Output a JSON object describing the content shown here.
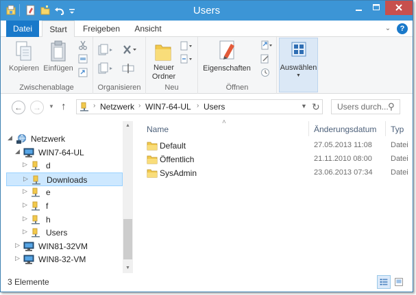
{
  "window": {
    "title": "Users",
    "accent": "#3c95d6",
    "close_color": "#c7504d"
  },
  "quick_access": {
    "icons": [
      "folder-properties-icon",
      "new-folder-icon",
      "undo-icon",
      "customize-dropdown-icon"
    ]
  },
  "ribbon_tabs": [
    {
      "label": "Datei"
    },
    {
      "label": "Start"
    },
    {
      "label": "Freigeben"
    },
    {
      "label": "Ansicht"
    }
  ],
  "help": {
    "label": "?"
  },
  "ribbon": {
    "zwischenablage": {
      "label": "Zwischenablage",
      "kopieren": "Kopieren",
      "einfuegen": "Einfügen"
    },
    "organisieren": {
      "label": "Organisieren"
    },
    "neu": {
      "label": "Neu",
      "neuer": "Neuer",
      "ordner": "Ordner"
    },
    "oeffnen": {
      "label": "Öffnen",
      "eigenschaften": "Eigenschaften"
    },
    "auswaehlen": {
      "label": "Auswählen"
    }
  },
  "address": {
    "crumbs": [
      "Netzwerk",
      "WIN7-64-UL",
      "Users"
    ]
  },
  "search": {
    "placeholder": "Users durch..."
  },
  "tree": [
    {
      "label": "Netzwerk",
      "level": 0,
      "expanded": true,
      "icon": "network-icon"
    },
    {
      "label": "WIN7-64-UL",
      "level": 1,
      "expanded": true,
      "icon": "computer-icon"
    },
    {
      "label": "d",
      "level": 2,
      "expanded": false,
      "icon": "share-folder-icon"
    },
    {
      "label": "Downloads",
      "level": 2,
      "expanded": false,
      "icon": "share-folder-icon",
      "selected": true
    },
    {
      "label": "e",
      "level": 2,
      "expanded": false,
      "icon": "share-folder-icon"
    },
    {
      "label": "f",
      "level": 2,
      "expanded": false,
      "icon": "share-folder-icon"
    },
    {
      "label": "h",
      "level": 2,
      "expanded": false,
      "icon": "share-folder-icon"
    },
    {
      "label": "Users",
      "level": 2,
      "expanded": false,
      "icon": "share-folder-icon"
    },
    {
      "label": "WIN81-32VM",
      "level": 1,
      "expanded": false,
      "icon": "computer-icon"
    },
    {
      "label": "WIN8-32-VM",
      "level": 1,
      "expanded": false,
      "icon": "computer-icon"
    }
  ],
  "columns": {
    "name": "Name",
    "date": "Änderungsdatum",
    "type": "Typ"
  },
  "files": [
    {
      "name": "Default",
      "date": "27.05.2013 11:08",
      "type": "Datei"
    },
    {
      "name": "Öffentlich",
      "date": "21.11.2010 08:00",
      "type": "Datei"
    },
    {
      "name": "SysAdmin",
      "date": "23.06.2013 07:34",
      "type": "Datei"
    }
  ],
  "status": {
    "count": "3 Elemente"
  }
}
